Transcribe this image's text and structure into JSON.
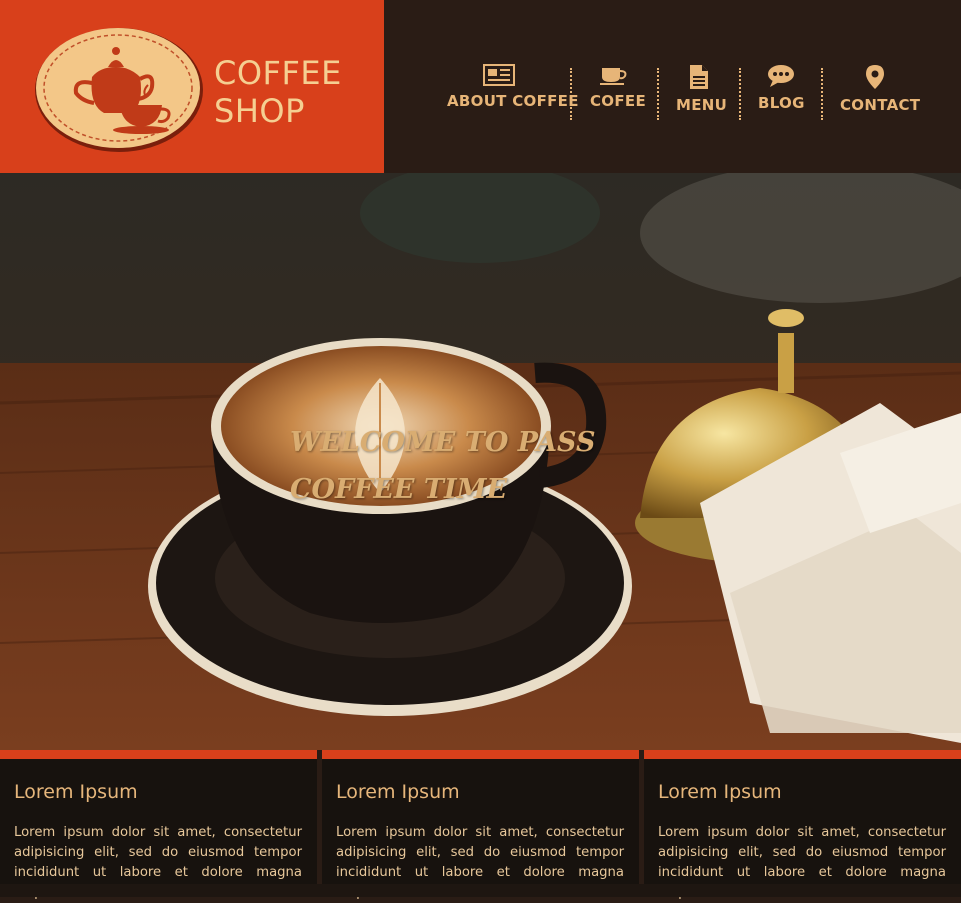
{
  "brand": {
    "name_line1": "COFFEE",
    "name_line2": "SHOP",
    "logo_icon": "teapot-and-cup-icon",
    "colors": {
      "brand_panel": "#d8401b",
      "header_dark": "#2a1c15",
      "accent_gold": "#e7b578"
    }
  },
  "nav": {
    "items": [
      {
        "label": "ABOUT COFFEE",
        "icon": "newspaper-icon"
      },
      {
        "label": "COFEE",
        "icon": "coffee-cup-icon"
      },
      {
        "label": "MENU",
        "icon": "document-icon"
      },
      {
        "label": "BLOG",
        "icon": "chat-bubble-icon"
      },
      {
        "label": "CONTACT",
        "icon": "map-pin-icon"
      }
    ]
  },
  "hero": {
    "title_line1": "WELCOME TO PASS",
    "title_line2": "COFFEE TIME",
    "image": "latte-cup-with-service-bell-and-receipts"
  },
  "cards": [
    {
      "title": "Lorem Ipsum",
      "text": "Lorem ipsum dolor sit amet, consectetur adipisicing elit, sed do eiusmod tempor incididunt ut labore et dolore magna aliqua."
    },
    {
      "title": "Lorem Ipsum",
      "text": "Lorem ipsum dolor sit amet, consectetur adipisicing elit, sed do eiusmod tempor incididunt ut labore et dolore magna aliqua."
    },
    {
      "title": "Lorem Ipsum",
      "text": "Lorem ipsum dolor sit amet, consectetur adipisicing elit, sed do eiusmod tempor incididunt ut labore et dolore magna aliqua."
    }
  ]
}
